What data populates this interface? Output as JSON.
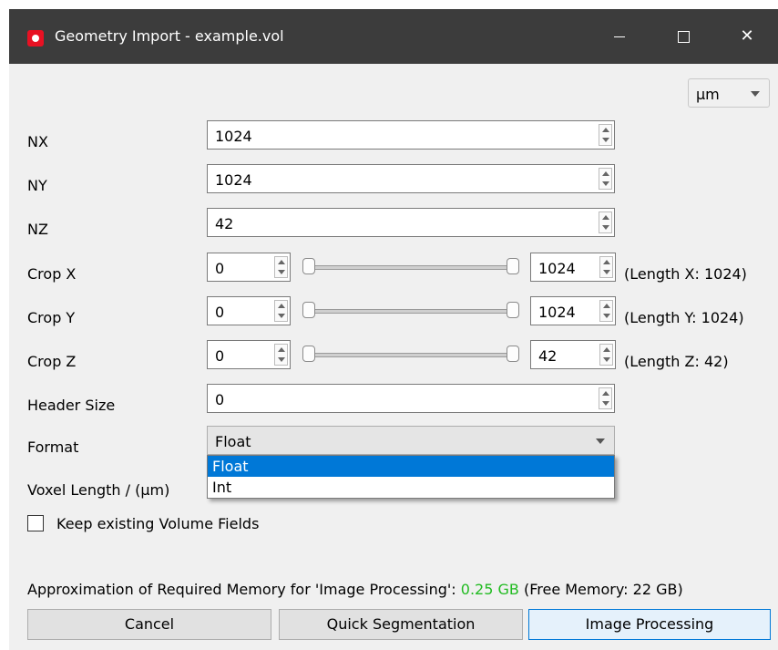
{
  "window": {
    "title": "Geometry Import - example.vol",
    "minimize_glyph": "—",
    "maximize_glyph": "☐",
    "close_glyph": "✕"
  },
  "unit_select": {
    "value": "µm"
  },
  "fields": {
    "nx": {
      "label": "NX",
      "value": "1024"
    },
    "ny": {
      "label": "NY",
      "value": "1024"
    },
    "nz": {
      "label": "NZ",
      "value": "42"
    },
    "header_size": {
      "label": "Header Size",
      "value": "0"
    }
  },
  "crop": {
    "x": {
      "label": "Crop X",
      "min": "0",
      "max": "1024",
      "length_text": "(Length X: 1024)"
    },
    "y": {
      "label": "Crop Y",
      "min": "0",
      "max": "1024",
      "length_text": "(Length Y: 1024)"
    },
    "z": {
      "label": "Crop Z",
      "min": "0",
      "max": "42",
      "length_text": "(Length Z: 42)"
    }
  },
  "format": {
    "label": "Format",
    "value": "Float",
    "options": [
      "Float",
      "Int"
    ],
    "highlighted": "Float"
  },
  "voxel_length": {
    "label": "Voxel Length / (µm)"
  },
  "keep_fields": {
    "label": "Keep existing Volume Fields",
    "checked": false
  },
  "memory": {
    "prefix": "Approximation of Required Memory for 'Image Processing':",
    "amount": "0.25 GB",
    "suffix": "(Free Memory: 22 GB)",
    "amount_color": "#22bb22"
  },
  "buttons": {
    "cancel": "Cancel",
    "quick_segmentation": "Quick Segmentation",
    "image_processing": "Image Processing"
  }
}
